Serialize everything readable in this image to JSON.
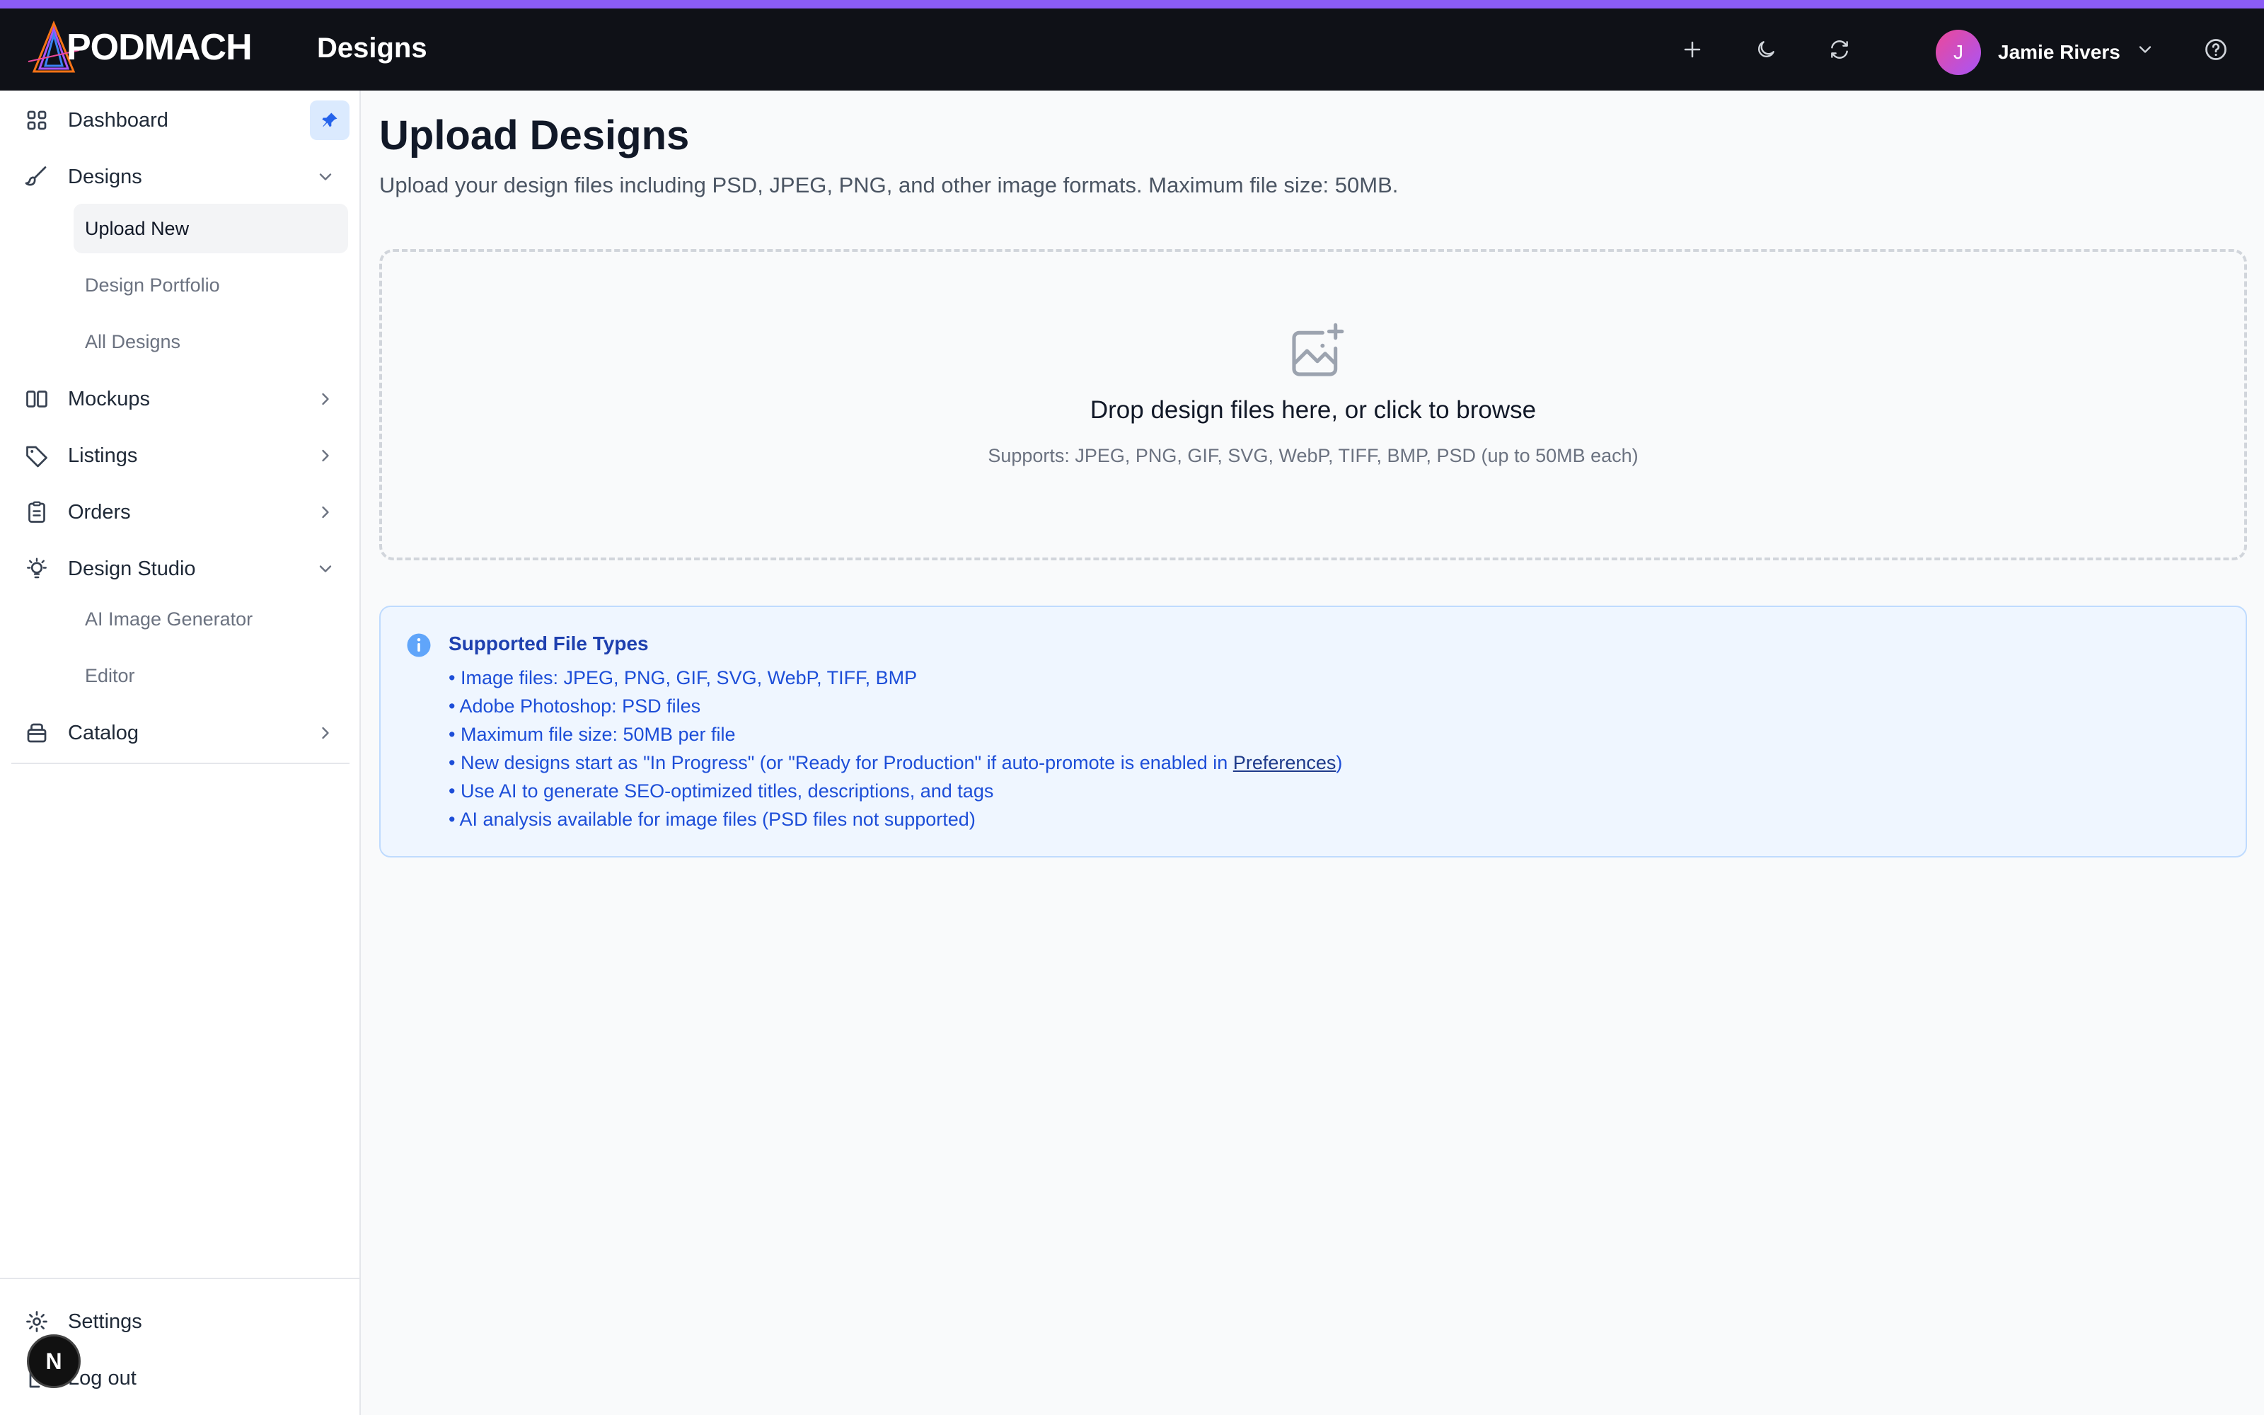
{
  "app": {
    "logo_text": "PODMACH",
    "header_title": "Designs",
    "accent_color": "#8b5cf6"
  },
  "header": {
    "icons": [
      "plus-icon",
      "moon-icon",
      "refresh-icon",
      "chevron-down-icon",
      "help-icon"
    ],
    "user": {
      "initial": "J",
      "name": "Jamie Rivers"
    }
  },
  "sidebar": {
    "items": [
      {
        "label": "Dashboard",
        "icon": "grid-icon"
      },
      {
        "label": "Designs",
        "icon": "brush-icon",
        "expanded": true,
        "children": [
          {
            "label": "Upload New",
            "active": true
          },
          {
            "label": "Design Portfolio"
          },
          {
            "label": "All Designs"
          }
        ]
      },
      {
        "label": "Mockups",
        "icon": "columns-icon"
      },
      {
        "label": "Listings",
        "icon": "tag-icon"
      },
      {
        "label": "Orders",
        "icon": "clipboard-icon"
      },
      {
        "label": "Design Studio",
        "icon": "lightbulb-icon",
        "expanded": true,
        "children": [
          {
            "label": "AI Image Generator"
          },
          {
            "label": "Editor"
          }
        ]
      },
      {
        "label": "Catalog",
        "icon": "box-icon"
      }
    ],
    "bottom": [
      {
        "label": "Settings",
        "icon": "gear-icon"
      },
      {
        "label": "Log out",
        "icon": "logout-icon"
      }
    ],
    "badge": "N"
  },
  "main": {
    "title": "Upload Designs",
    "subtitle": "Upload your design files including PSD, JPEG, PNG, and other image formats. Maximum file size: 50MB.",
    "dropzone": {
      "title": "Drop design files here, or click to browse",
      "supports": "Supports: JPEG, PNG, GIF, SVG, WebP, TIFF, BMP, PSD (up to 50MB each)"
    },
    "info": {
      "title": "Supported File Types",
      "items": [
        "• Image files: JPEG, PNG, GIF, SVG, WebP, TIFF, BMP",
        "• Adobe Photoshop: PSD files",
        "• Maximum file size: 50MB per file",
        "• New designs start as \"In Progress\" (or \"Ready for Production\" if auto-promote is enabled in ",
        "• Use AI to generate SEO-optimized titles, descriptions, and tags",
        "• AI analysis available for image files (PSD files not supported)"
      ],
      "link_label": "Preferences",
      "link_suffix": ")"
    }
  }
}
